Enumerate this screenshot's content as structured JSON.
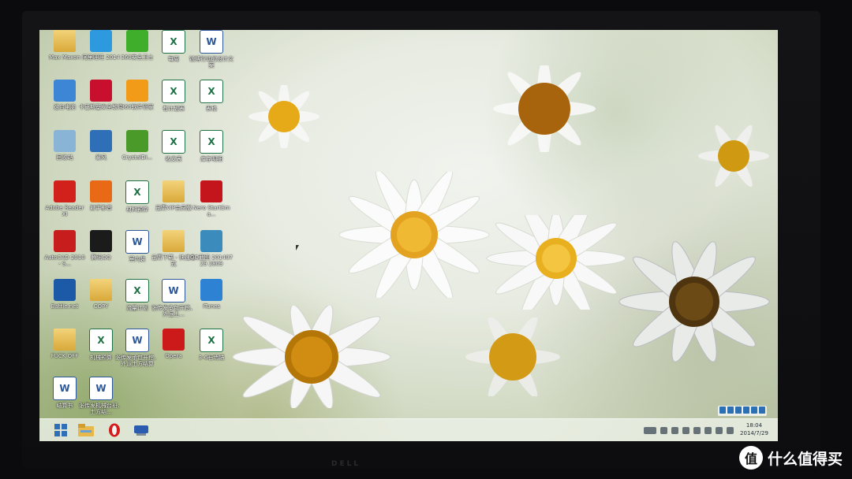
{
  "desktop": {
    "icons": [
      {
        "label": "Max Maxon",
        "icon": "user-folder-icon"
      },
      {
        "label": "阿里旺旺 2014",
        "icon": "aliwangwang-icon"
      },
      {
        "label": "360安全卫士",
        "icon": "360-safe-icon"
      },
      {
        "label": "每周",
        "icon": "excel-icon"
      },
      {
        "label": "锐博行动的设计文案",
        "icon": "word-icon"
      },
      {
        "label": "这台电脑",
        "icon": "computer-icon"
      },
      {
        "label": "卡巴斯基安全软件",
        "icon": "kaspersky-icon"
      },
      {
        "label": "360软件管家",
        "icon": "360-software-icon"
      },
      {
        "label": "有计划表",
        "icon": "excel-icon"
      },
      {
        "label": "表格",
        "icon": "excel-icon"
      },
      {
        "label": "回收站",
        "icon": "recycle-bin-icon"
      },
      {
        "label": "暴风",
        "icon": "media-player-icon"
      },
      {
        "label": "CrystalDi...",
        "icon": "crystaldisk-icon"
      },
      {
        "label": "收支表",
        "icon": "excel-icon"
      },
      {
        "label": "库存明细",
        "icon": "excel-icon"
      },
      {
        "label": "Adobe Reader XI",
        "icon": "adobe-reader-icon"
      },
      {
        "label": "射手影音",
        "icon": "shooter-player-icon"
      },
      {
        "label": "材料预算",
        "icon": "excel-icon"
      },
      {
        "label": "迅雷VIP会员版",
        "icon": "folder-icon"
      },
      {
        "label": "Nero StartSma...",
        "icon": "nero-icon"
      },
      {
        "label": "AutoCAD 2010 - S...",
        "icon": "autocad-icon"
      },
      {
        "label": "腾讯QQ",
        "icon": "qq-icon"
      },
      {
        "label": "室内装",
        "icon": "word-icon"
      },
      {
        "label": "迅雷下载 - 快速方式",
        "icon": "folder-icon"
      },
      {
        "label": "QQ截图 20140729 2809",
        "icon": "image-icon"
      },
      {
        "label": "Battle.net",
        "icon": "battlenet-icon"
      },
      {
        "label": "COPY",
        "icon": "folder-icon"
      },
      {
        "label": "流量计划",
        "icon": "excel-icon"
      },
      {
        "label": "张传发承包开挖、外运土...",
        "icon": "word-icon"
      },
      {
        "label": "iTunes",
        "icon": "itunes-icon"
      },
      {
        "label": "FUCK OFF",
        "icon": "folder-icon"
      },
      {
        "label": "机械预算",
        "icon": "excel-icon"
      },
      {
        "label": "张传发承包开挖、外运土方结算",
        "icon": "word-icon"
      },
      {
        "label": "Opera",
        "icon": "opera-icon"
      },
      {
        "label": "3-6石墙锚",
        "icon": "excel-icon"
      },
      {
        "label": "结算书",
        "icon": "word-icon"
      },
      {
        "label": "张传发机械台班、土方结...",
        "icon": "word-icon"
      }
    ]
  },
  "taskbar": {
    "pinned": [
      "windows-start-icon",
      "file-explorer-icon",
      "opera-icon",
      "network-app-icon"
    ],
    "clock_time": "18:04",
    "clock_date": "2014/7/29"
  },
  "watermark": {
    "logo_text": "值",
    "text": "什么值得买"
  },
  "monitor": {
    "brand": "DELL"
  },
  "colors": {
    "excel": "#1e7145",
    "word": "#2b579a",
    "taskbar": "#ebf0e6"
  }
}
